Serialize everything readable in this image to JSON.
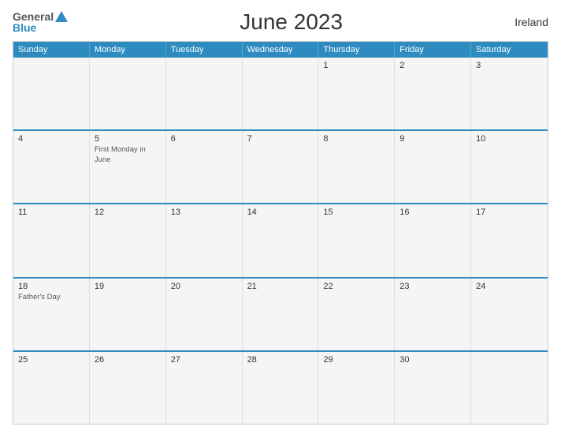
{
  "header": {
    "logo_general": "General",
    "logo_blue": "Blue",
    "title": "June 2023",
    "country": "Ireland"
  },
  "days_of_week": [
    "Sunday",
    "Monday",
    "Tuesday",
    "Wednesday",
    "Thursday",
    "Friday",
    "Saturday"
  ],
  "weeks": [
    [
      {
        "day": "",
        "event": ""
      },
      {
        "day": "",
        "event": ""
      },
      {
        "day": "",
        "event": ""
      },
      {
        "day": "",
        "event": ""
      },
      {
        "day": "1",
        "event": ""
      },
      {
        "day": "2",
        "event": ""
      },
      {
        "day": "3",
        "event": ""
      }
    ],
    [
      {
        "day": "4",
        "event": ""
      },
      {
        "day": "5",
        "event": "First Monday in June"
      },
      {
        "day": "6",
        "event": ""
      },
      {
        "day": "7",
        "event": ""
      },
      {
        "day": "8",
        "event": ""
      },
      {
        "day": "9",
        "event": ""
      },
      {
        "day": "10",
        "event": ""
      }
    ],
    [
      {
        "day": "11",
        "event": ""
      },
      {
        "day": "12",
        "event": ""
      },
      {
        "day": "13",
        "event": ""
      },
      {
        "day": "14",
        "event": ""
      },
      {
        "day": "15",
        "event": ""
      },
      {
        "day": "16",
        "event": ""
      },
      {
        "day": "17",
        "event": ""
      }
    ],
    [
      {
        "day": "18",
        "event": "Father's Day"
      },
      {
        "day": "19",
        "event": ""
      },
      {
        "day": "20",
        "event": ""
      },
      {
        "day": "21",
        "event": ""
      },
      {
        "day": "22",
        "event": ""
      },
      {
        "day": "23",
        "event": ""
      },
      {
        "day": "24",
        "event": ""
      }
    ],
    [
      {
        "day": "25",
        "event": ""
      },
      {
        "day": "26",
        "event": ""
      },
      {
        "day": "27",
        "event": ""
      },
      {
        "day": "28",
        "event": ""
      },
      {
        "day": "29",
        "event": ""
      },
      {
        "day": "30",
        "event": ""
      },
      {
        "day": "",
        "event": ""
      }
    ]
  ]
}
